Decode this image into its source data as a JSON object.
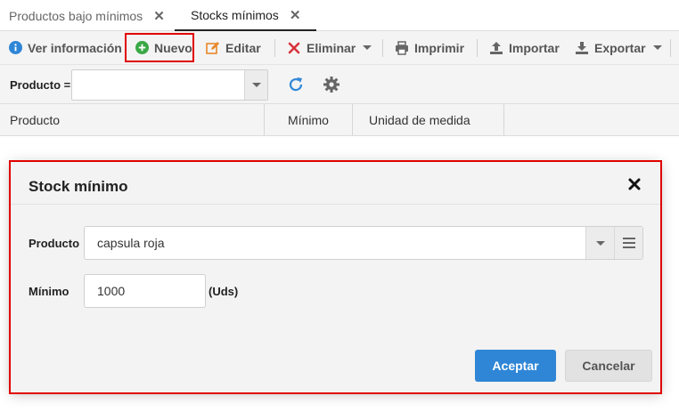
{
  "tabs": [
    {
      "label": "Productos bajo mínimos"
    },
    {
      "label": "Stocks mínimos"
    }
  ],
  "toolbar": {
    "ver_informacion": "Ver información",
    "nuevo": "Nuevo",
    "editar": "Editar",
    "eliminar": "Eliminar",
    "imprimir": "Imprimir",
    "importar": "Importar",
    "exportar": "Exportar"
  },
  "filter": {
    "label": "Producto =",
    "value": ""
  },
  "grid": {
    "columns": [
      "Producto",
      "Mínimo",
      "Unidad de medida"
    ]
  },
  "dialog": {
    "title": "Stock mínimo",
    "producto_label": "Producto",
    "producto_value": "capsula roja",
    "minimo_label": "Mínimo",
    "minimo_value": "1000",
    "unit": "(Uds)",
    "accept": "Aceptar",
    "cancel": "Cancelar"
  },
  "colors": {
    "accent": "#2f86d6",
    "highlight": "#e00000",
    "nuevo_icon": "#3aa845",
    "editar_icon": "#e8872a",
    "eliminar_icon": "#d9323b"
  }
}
